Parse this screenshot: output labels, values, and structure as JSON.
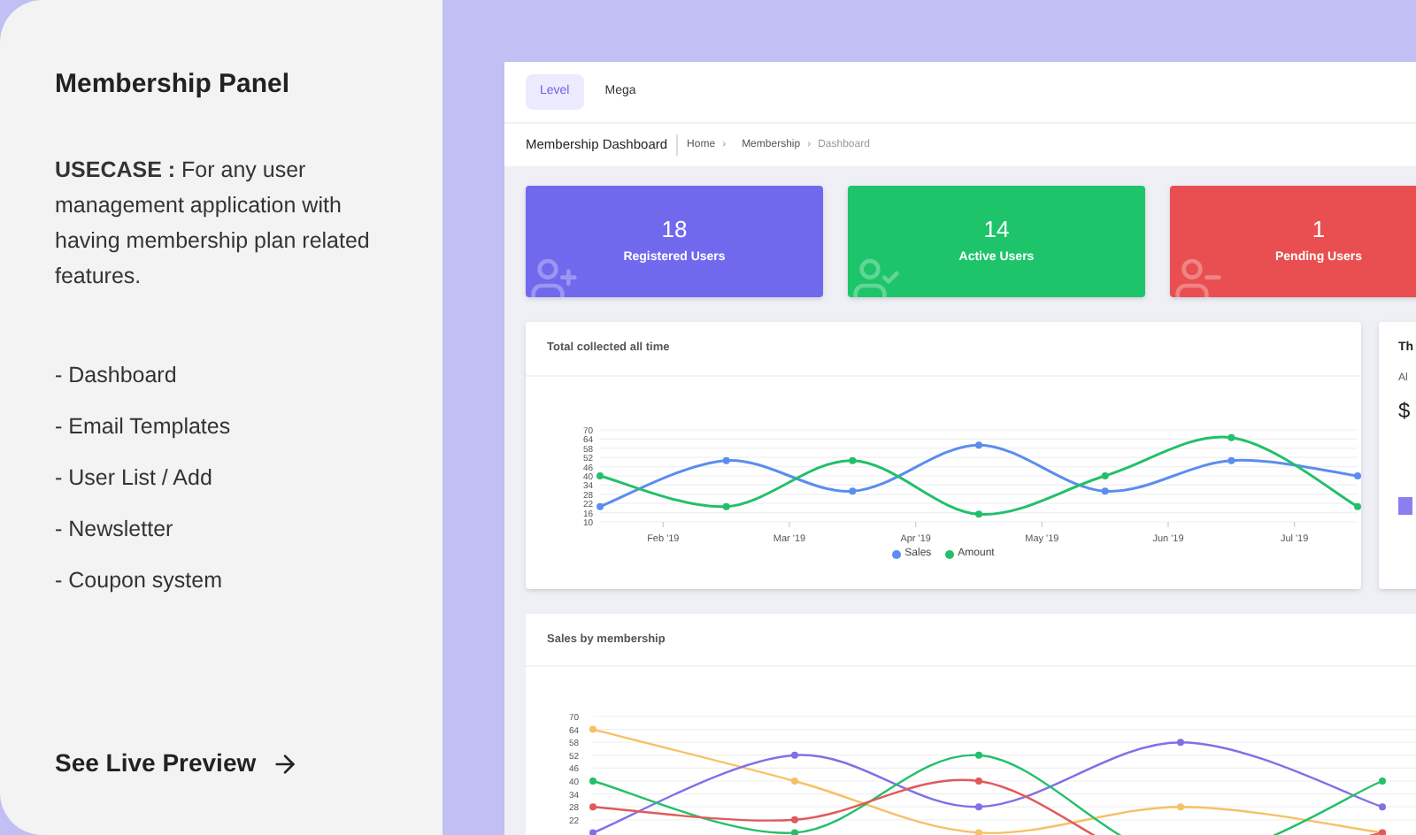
{
  "info_panel": {
    "title": "Membership Panel",
    "description": "**USECASE :** For any user management application with having membership plan related features.",
    "features": [
      "- Dashboard",
      "- Email Templates",
      "- User List / Add",
      "- Newsletter",
      "- Coupon system"
    ],
    "cta": "See Live Preview"
  },
  "dashboard": {
    "tabs": [
      {
        "label": "Level",
        "selected": true
      },
      {
        "label": "Mega",
        "selected": false
      }
    ],
    "page_title": "Membership Dashboard",
    "breadcrumb": [
      "Home",
      "Membership",
      "Dashboard"
    ],
    "breadcrumb_separator": "›",
    "stat_cards": [
      {
        "value": "18",
        "label": "Registered Users",
        "kind": "registered",
        "color": "#7069ee"
      },
      {
        "value": "14",
        "label": "Active Users",
        "kind": "active",
        "color": "#1ec46a"
      },
      {
        "value": "1",
        "label": "Pending Users",
        "kind": "pending",
        "color": "#e94f50"
      }
    ],
    "total_chart": {
      "title": "Total collected all time",
      "chart_data": {
        "type": "line",
        "grid": true,
        "legend": "bottom",
        "categories": [
          null,
          "Feb '19",
          null,
          "Mar '19",
          null,
          "Apr '19",
          null,
          "May '19",
          null,
          "Jun '19",
          null,
          "Jul '19",
          null
        ],
        "ylim": [
          10,
          70
        ],
        "yticks": [
          10,
          16,
          22,
          28,
          34,
          40,
          46,
          52,
          58,
          64,
          70
        ],
        "series": [
          {
            "name": "Sales",
            "color": "#5b8def",
            "marker": true,
            "values": [
              20,
              null,
              50,
              null,
              30,
              null,
              60,
              null,
              30,
              null,
              50,
              null,
              40
            ]
          },
          {
            "name": "Amount",
            "color": "#22c06a",
            "marker": true,
            "values": [
              40,
              null,
              20,
              null,
              50,
              null,
              15,
              null,
              40,
              null,
              65,
              null,
              20
            ]
          }
        ]
      }
    },
    "side_card": {
      "title": "Th",
      "subtitle": "Al",
      "amount": "$"
    },
    "membership_chart": {
      "title": "Sales by membership",
      "y_labels": [
        "70",
        "64",
        "58",
        "52",
        "46",
        "40",
        "34",
        "28",
        "22"
      ]
    }
  }
}
